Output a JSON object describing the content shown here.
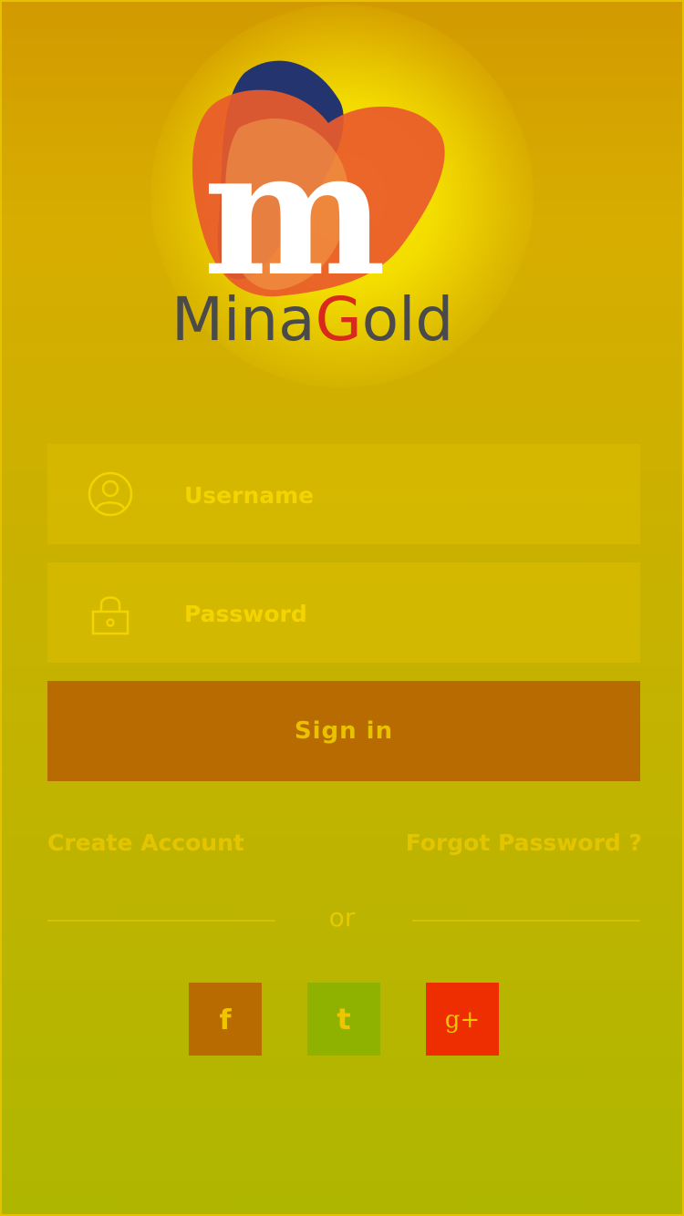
{
  "brand": {
    "name_prefix": "MinaG",
    "name_accent_letter": "G",
    "name_first": "Mina",
    "name_last": "old",
    "logo_letter": "m",
    "colors": {
      "logo_orange": "#e65a2a",
      "logo_navy": "#23346e",
      "logo_text": "#4a4a4a",
      "logo_accent": "#d9281c"
    }
  },
  "login": {
    "username": {
      "placeholder": "Username",
      "value": "",
      "icon": "user-icon"
    },
    "password": {
      "placeholder": "Password",
      "value": "",
      "icon": "lock-icon"
    },
    "signin_label": "Sign in"
  },
  "links": {
    "create_account": "Create Account",
    "forgot_password": "Forgot Password ?"
  },
  "divider_text": "or",
  "social": [
    {
      "name": "facebook",
      "glyph": "f",
      "color": "#b86b00",
      "icon": "facebook-icon"
    },
    {
      "name": "twitter",
      "glyph": "t",
      "color": "#8fb100",
      "icon": "twitter-icon"
    },
    {
      "name": "google-plus",
      "glyph": "g+",
      "color": "#ee2d00",
      "icon": "google-plus-icon"
    }
  ],
  "theme": {
    "background_top": "#d29a00",
    "background_bottom": "#afb600",
    "field_text": "#f3d300",
    "button": "#b86b00"
  }
}
